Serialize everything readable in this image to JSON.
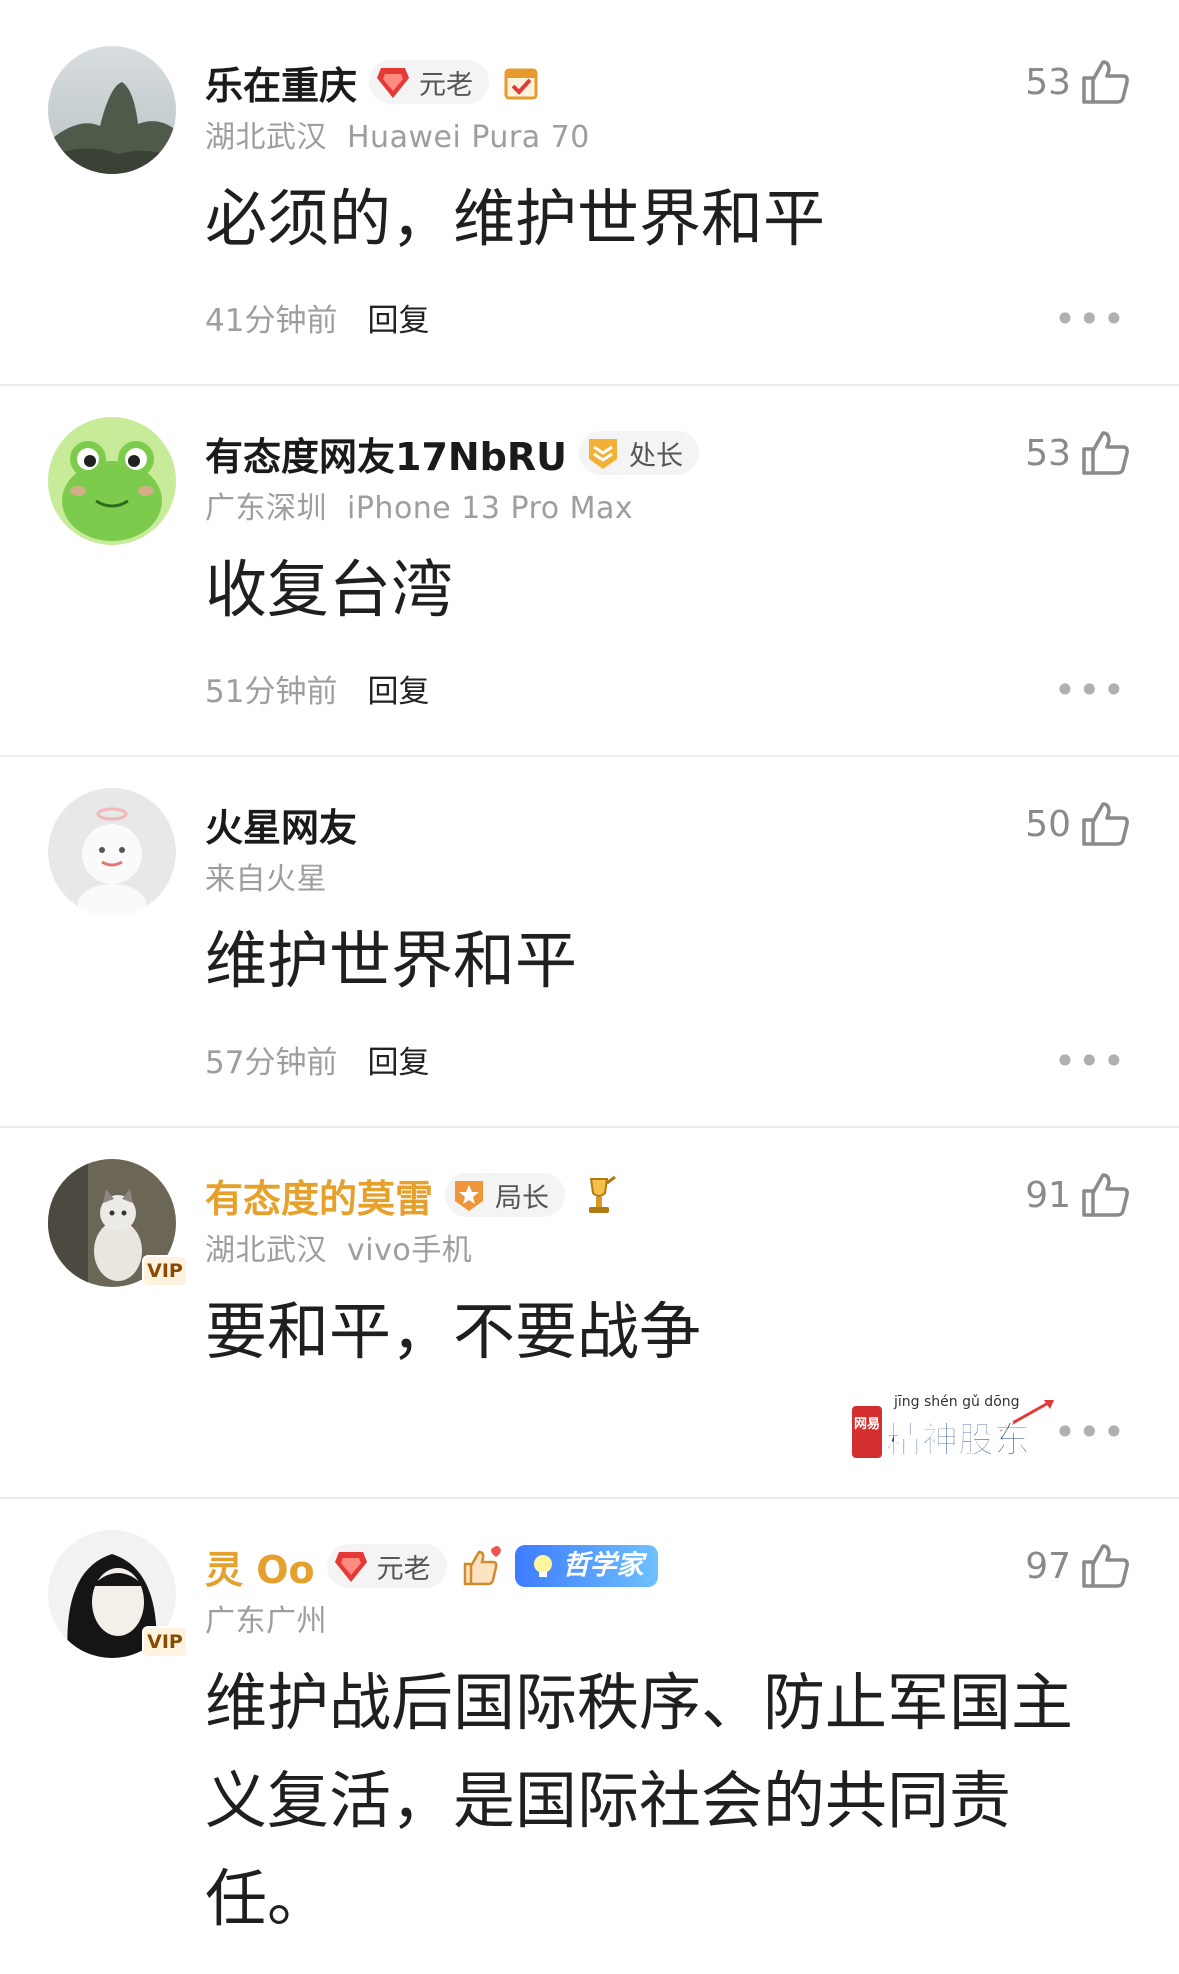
{
  "comments": [
    {
      "user": "乐在重庆",
      "badge": "元老",
      "location": "湖北武汉",
      "device": "Huawei Pura 70",
      "text": "必须的，维护世界和平",
      "time": "41分钟前",
      "reply": "回复",
      "likes": "53"
    },
    {
      "user": "有态度网友17NbRU",
      "badge": "处长",
      "location": "广东深圳",
      "device": "iPhone 13 Pro Max",
      "text": "收复台湾",
      "time": "51分钟前",
      "reply": "回复",
      "likes": "53"
    },
    {
      "user": "火星网友",
      "location": "来自火星",
      "text": "维护世界和平",
      "time": "57分钟前",
      "reply": "回复",
      "likes": "50"
    },
    {
      "user": "有态度的莫雷",
      "badge": "局长",
      "location": "湖北武汉",
      "device": "vivo手机",
      "text": "要和平，不要战争",
      "likes": "91",
      "vip": "VIP"
    },
    {
      "user": "灵 Oo",
      "badge": "元老",
      "title_tag": "哲学家",
      "location": "广东广州",
      "text": "维护战后国际秩序、防止军国主义复活，是国际社会的共同责任。",
      "likes": "97",
      "vip": "VIP"
    }
  ],
  "watermark": {
    "brand_small": "网易",
    "brand_main": "精神股东",
    "pinyin": "jīng shén gǔ dōng"
  },
  "more_glyph": "•••",
  "colors": {
    "gold_name": "#e5a12c",
    "meta_gray": "#9e9e9e",
    "divider": "#ececec"
  }
}
